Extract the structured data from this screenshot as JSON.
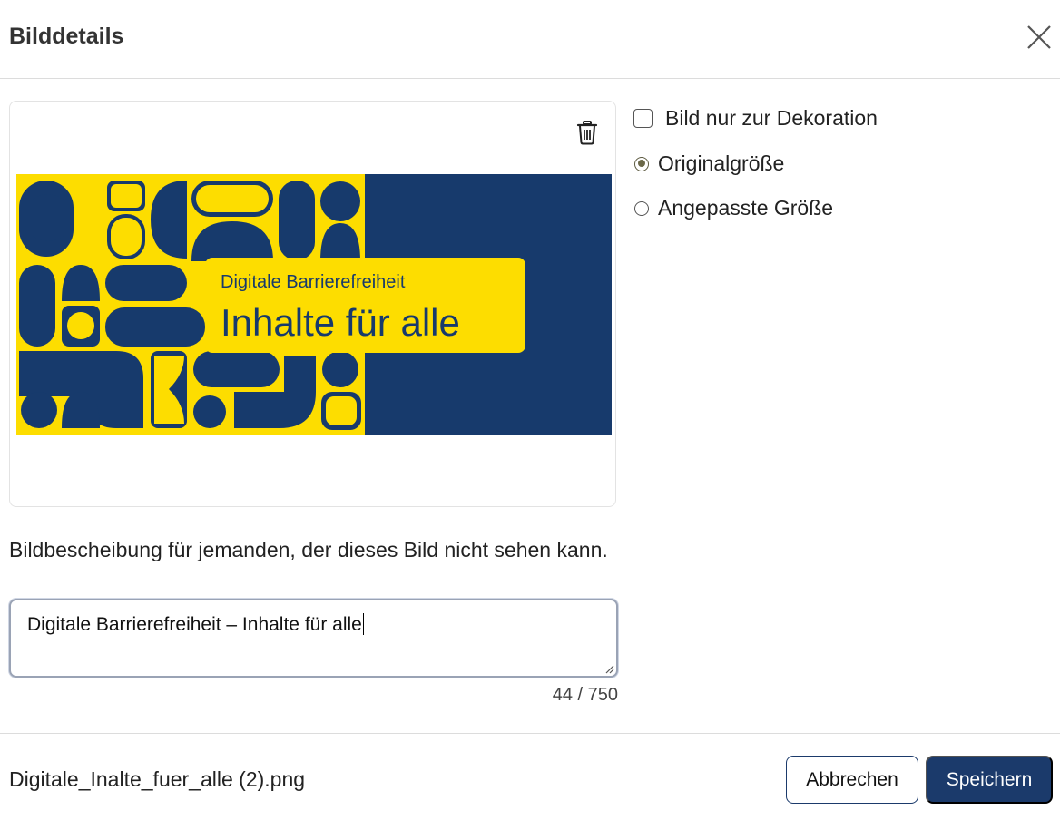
{
  "dialog": {
    "title": "Bilddetails"
  },
  "options": {
    "decorative_label": "Bild nur zur Dekoration",
    "decorative_checked": false,
    "size_options": [
      {
        "label": "Originalgröße",
        "checked": true
      },
      {
        "label": "Angepasste Größe",
        "checked": false
      }
    ]
  },
  "image": {
    "subtitle": "Digitale Barrierefreiheit",
    "headline": "Inhalte für alle",
    "colors": {
      "navy": "#173a6c",
      "yellow": "#fddd00"
    }
  },
  "description": {
    "label": "Bildbescheibung für jemanden, der dieses Bild nicht sehen kann.",
    "value": "Digitale Barrierefreiheit – Inhalte für alle",
    "counter": "44 / 750"
  },
  "footer": {
    "filename": "Digitale_Inalte_fuer_alle (2).png",
    "cancel_label": "Abbrechen",
    "save_label": "Speichern"
  },
  "colors": {
    "primary": "#1b3a6b",
    "radio_checked": "#6b6848"
  }
}
